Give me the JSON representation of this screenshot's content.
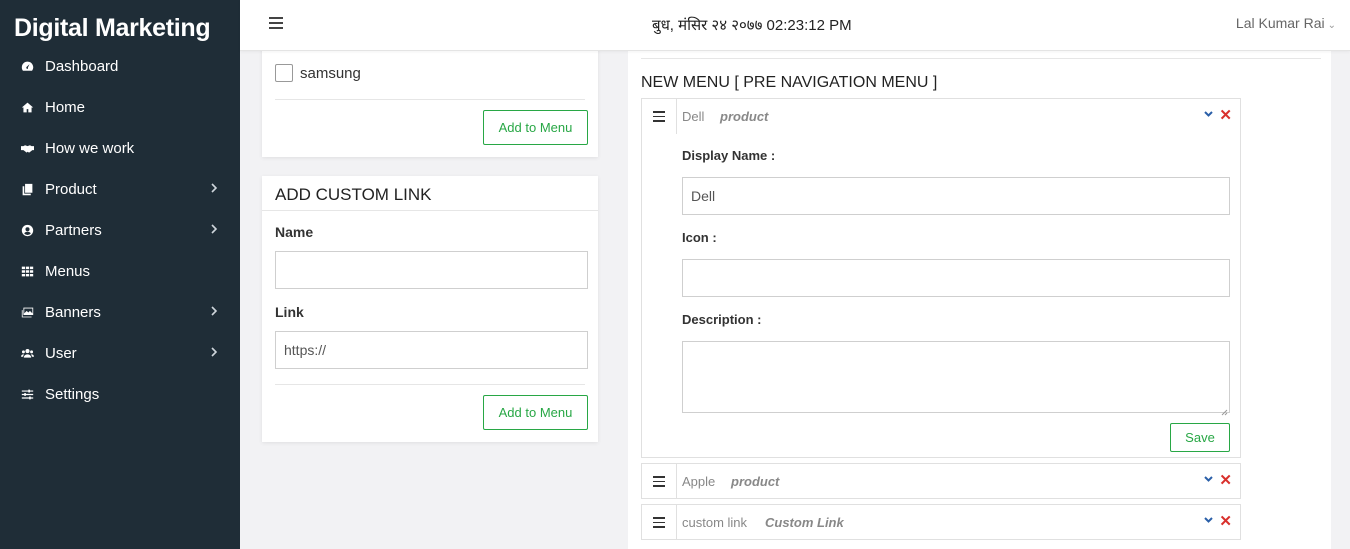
{
  "app": {
    "brand": "Digital Marketing"
  },
  "sidebar": {
    "items": [
      {
        "label": "Dashboard",
        "icon": "dashboard-icon",
        "has_submenu": false
      },
      {
        "label": "Home",
        "icon": "home-icon",
        "has_submenu": false
      },
      {
        "label": "How we work",
        "icon": "handshake-icon",
        "has_submenu": false
      },
      {
        "label": "Product",
        "icon": "copy-icon",
        "has_submenu": true
      },
      {
        "label": "Partners",
        "icon": "user-circle-icon",
        "has_submenu": true
      },
      {
        "label": "Menus",
        "icon": "grid-icon",
        "has_submenu": false
      },
      {
        "label": "Banners",
        "icon": "images-icon",
        "has_submenu": true
      },
      {
        "label": "User",
        "icon": "users-icon",
        "has_submenu": true
      },
      {
        "label": "Settings",
        "icon": "sliders-icon",
        "has_submenu": false
      }
    ]
  },
  "header": {
    "datetime": "बुध, मंसिर २४ २०७७ 02:23:12 PM",
    "user_name": "Lal Kumar Rai",
    "user_caret": "⌄"
  },
  "products_card": {
    "checkbox_label": "samsung",
    "add_button": "Add to Menu"
  },
  "custom_link": {
    "title": "ADD CUSTOM LINK",
    "name_label": "Name",
    "name_value": "",
    "link_label": "Link",
    "link_value": "https://",
    "add_button": "Add to Menu"
  },
  "menu_panel": {
    "title": "NEW MENU [ PRE NAVIGATION MENU ]",
    "items": [
      {
        "name": "Dell",
        "type": "product",
        "expanded": true,
        "display_name_label": "Display Name :",
        "display_name_value": "Dell",
        "icon_label": "Icon :",
        "icon_value": "",
        "description_label": "Description :",
        "description_value": "",
        "save_button": "Save"
      },
      {
        "name": "Apple",
        "type": "product",
        "expanded": false
      },
      {
        "name": "custom link",
        "type": "Custom Link",
        "expanded": false
      }
    ],
    "remove_glyph": "✕"
  },
  "colors": {
    "sidebar_bg": "#1f2d37",
    "accent_green": "#28a745",
    "remove_red": "#d9302c",
    "toggle_blue": "#2a5fa8"
  }
}
